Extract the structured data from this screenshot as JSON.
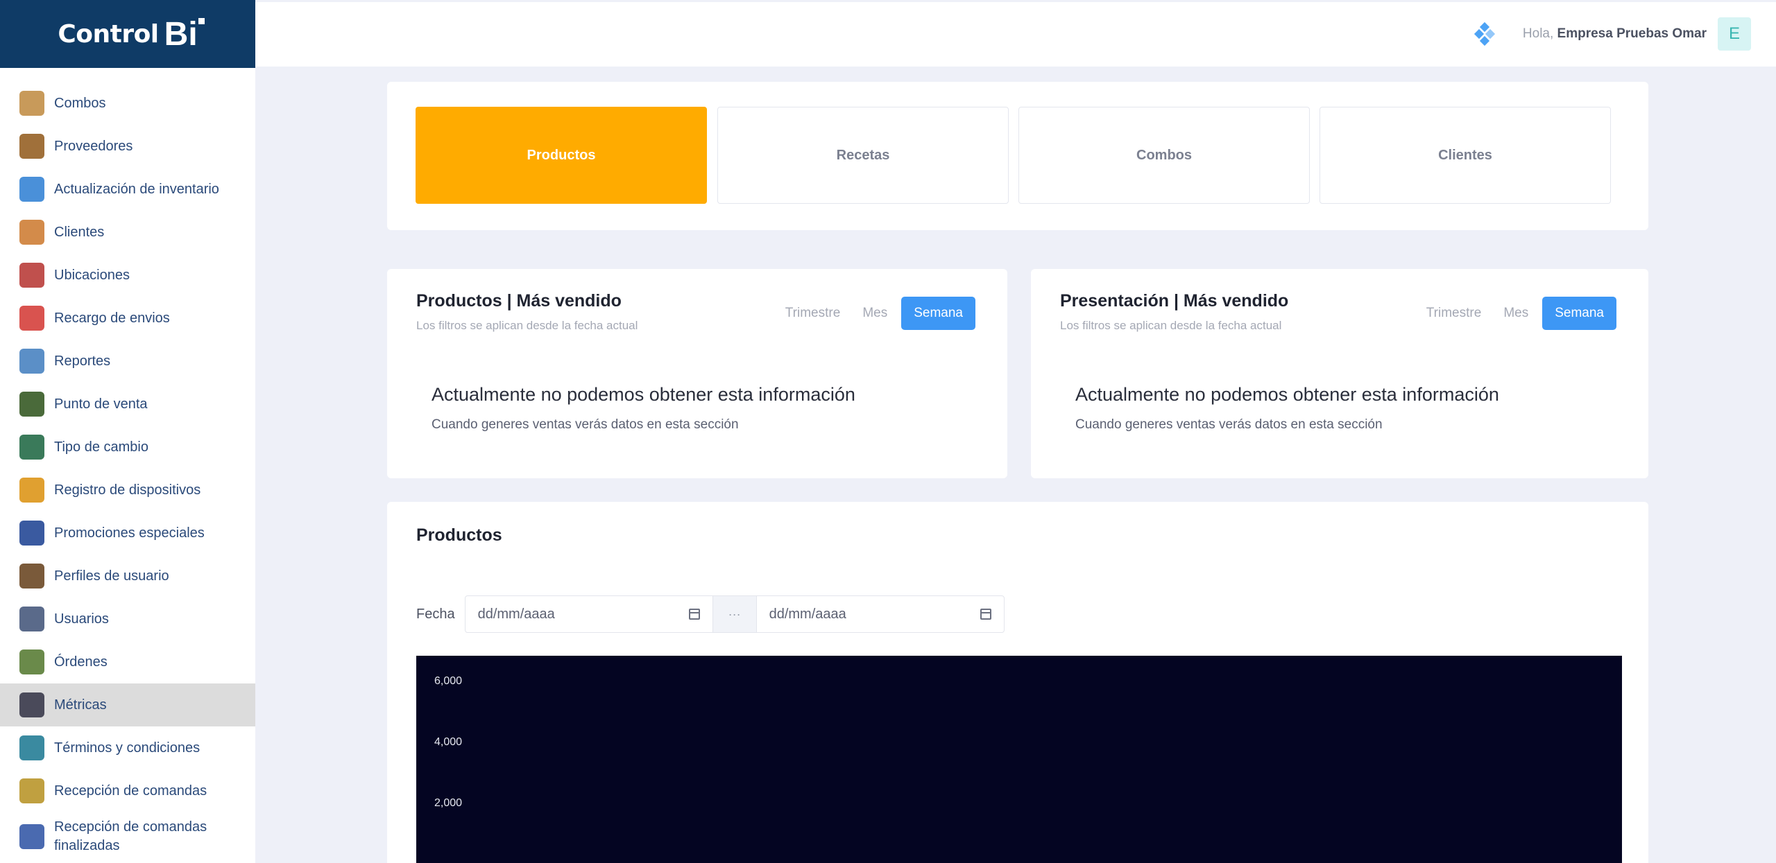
{
  "sidebar": {
    "logo_text": "Control",
    "logo_mark": "Bi",
    "items": [
      {
        "label": "Combos",
        "icon": "combo-icon",
        "color": "#c89a5a"
      },
      {
        "label": "Proveedores",
        "icon": "supplier-icon",
        "color": "#a0703a"
      },
      {
        "label": "Actualización de inventario",
        "icon": "inventory-icon",
        "color": "#4a90d9"
      },
      {
        "label": "Clientes",
        "icon": "clients-icon",
        "color": "#d38b4a"
      },
      {
        "label": "Ubicaciones",
        "icon": "location-icon",
        "color": "#c0504d"
      },
      {
        "label": "Recargo de envios",
        "icon": "delivery-icon",
        "color": "#d9534f"
      },
      {
        "label": "Reportes",
        "icon": "reports-icon",
        "color": "#5b8fc7"
      },
      {
        "label": "Punto de venta",
        "icon": "pos-icon",
        "color": "#4a6a3a"
      },
      {
        "label": "Tipo de cambio",
        "icon": "exchange-icon",
        "color": "#3a7a5a"
      },
      {
        "label": "Registro de dispositivos",
        "icon": "devices-icon",
        "color": "#e0a030"
      },
      {
        "label": "Promociones especiales",
        "icon": "promo-icon",
        "color": "#3a5aa0"
      },
      {
        "label": "Perfiles de usuario",
        "icon": "profile-icon",
        "color": "#7a5a3a"
      },
      {
        "label": "Usuarios",
        "icon": "users-icon",
        "color": "#5a6a8a"
      },
      {
        "label": "Órdenes",
        "icon": "orders-icon",
        "color": "#6a8a4a"
      },
      {
        "label": "Métricas",
        "icon": "metrics-icon",
        "color": "#4a4a5a",
        "active": true
      },
      {
        "label": "Términos y condiciones",
        "icon": "terms-icon",
        "color": "#3a8aa0"
      },
      {
        "label": "Recepción de comandas",
        "icon": "clipboard-icon",
        "color": "#c0a040"
      },
      {
        "label": "Recepción de comandas finalizadas",
        "icon": "bag-icon",
        "color": "#4a6ab0"
      }
    ]
  },
  "topbar": {
    "greeting": "Hola,",
    "user_name": "Empresa Pruebas Omar",
    "avatar_letter": "E"
  },
  "tabs": [
    {
      "label": "Productos",
      "active": true
    },
    {
      "label": "Recetas"
    },
    {
      "label": "Combos"
    },
    {
      "label": "Clientes"
    }
  ],
  "panels": [
    {
      "title": "Productos | Más vendido",
      "subtitle": "Los filtros se aplican desde la fecha actual",
      "filters": [
        "Trimestre",
        "Mes",
        "Semana"
      ],
      "active_filter": "Semana",
      "empty_title": "Actualmente no podemos obtener esta información",
      "empty_text": "Cuando generes ventas verás datos en esta sección"
    },
    {
      "title": "Presentación | Más vendido",
      "subtitle": "Los filtros se aplican desde la fecha actual",
      "filters": [
        "Trimestre",
        "Mes",
        "Semana"
      ],
      "active_filter": "Semana",
      "empty_title": "Actualmente no podemos obtener esta información",
      "empty_text": "Cuando generes ventas verás datos en esta sección"
    }
  ],
  "products_section": {
    "title": "Productos",
    "date_label": "Fecha",
    "date_from_placeholder": "dd/mm/aaaa",
    "date_to_placeholder": "dd/mm/aaaa",
    "separator": "···"
  },
  "chart_data": {
    "type": "bar",
    "title": "",
    "xlabel": "",
    "ylabel": "",
    "y_ticks": [
      "6,000",
      "4,000",
      "2,000"
    ],
    "ylim": [
      0,
      6000
    ],
    "categories": [],
    "values": [],
    "background": "#040522"
  },
  "colors": {
    "accent_tab": "#ffab00",
    "accent_filter": "#3d97f5",
    "sidebar_header": "#0f3b66"
  }
}
